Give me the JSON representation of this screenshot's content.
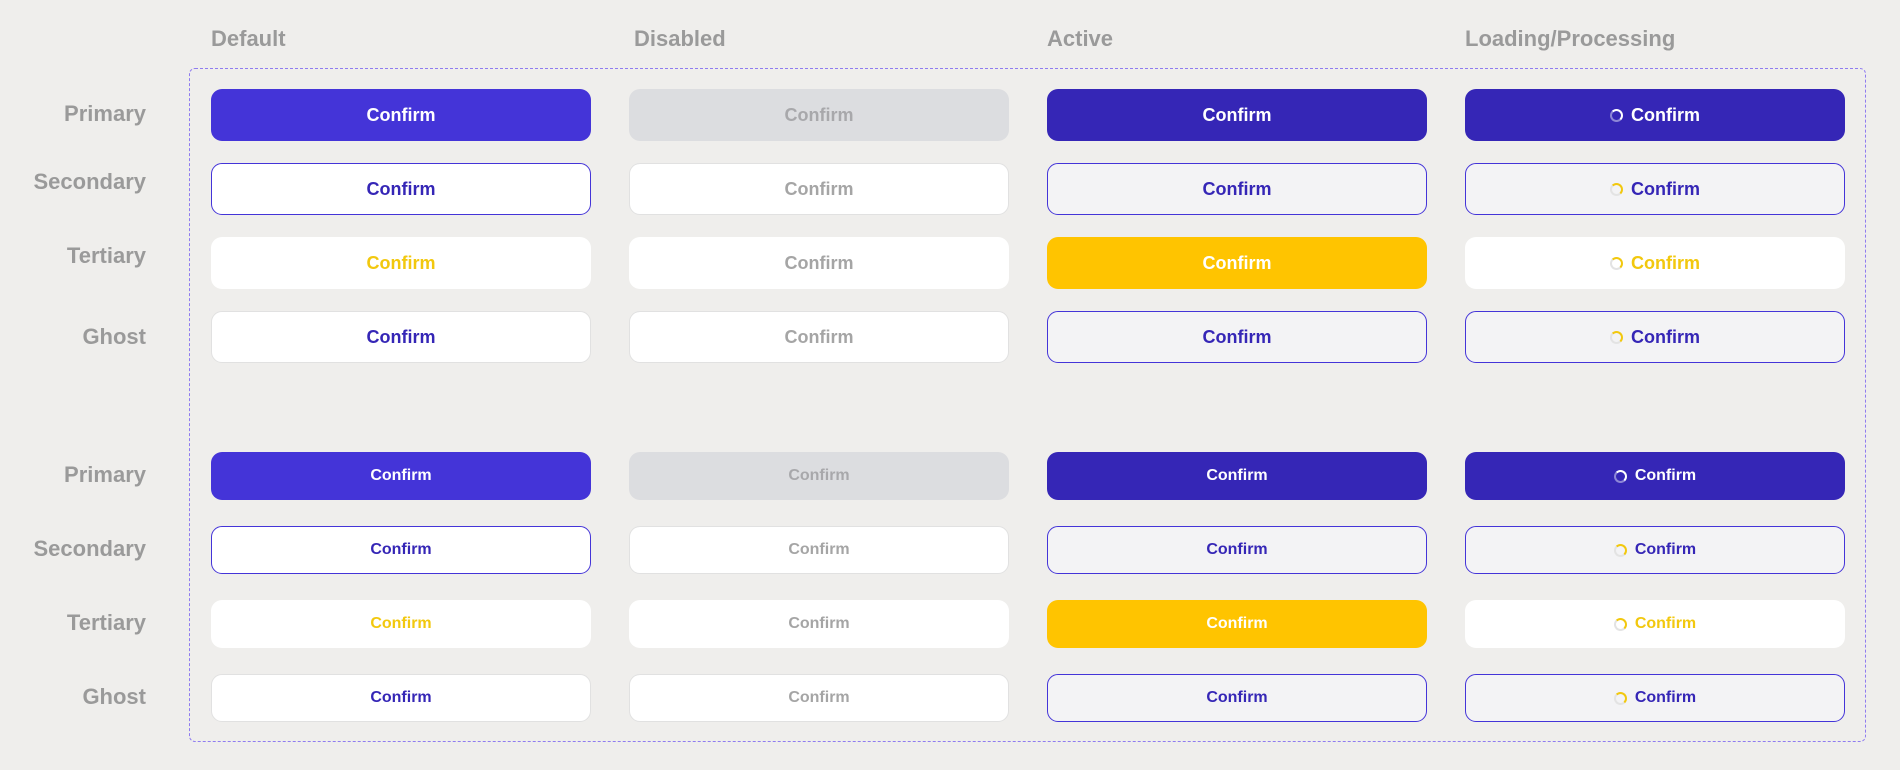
{
  "columns": [
    "Default",
    "Disabled",
    "Active",
    "Loading/Processing"
  ],
  "rows": [
    "Primary",
    "Secondary",
    "Tertiary",
    "Ghost"
  ],
  "button_label": "Confirm",
  "colors": {
    "background": "#efeeec",
    "primary": "#4434d8",
    "primary_active": "#3526b6",
    "disabled": "#dcdde0",
    "tertiary_accent": "#ffc400",
    "text_muted": "#9a9a9a",
    "dashed_border": "#8f7cf0"
  },
  "icons": {
    "loading": "spinner-icon"
  }
}
